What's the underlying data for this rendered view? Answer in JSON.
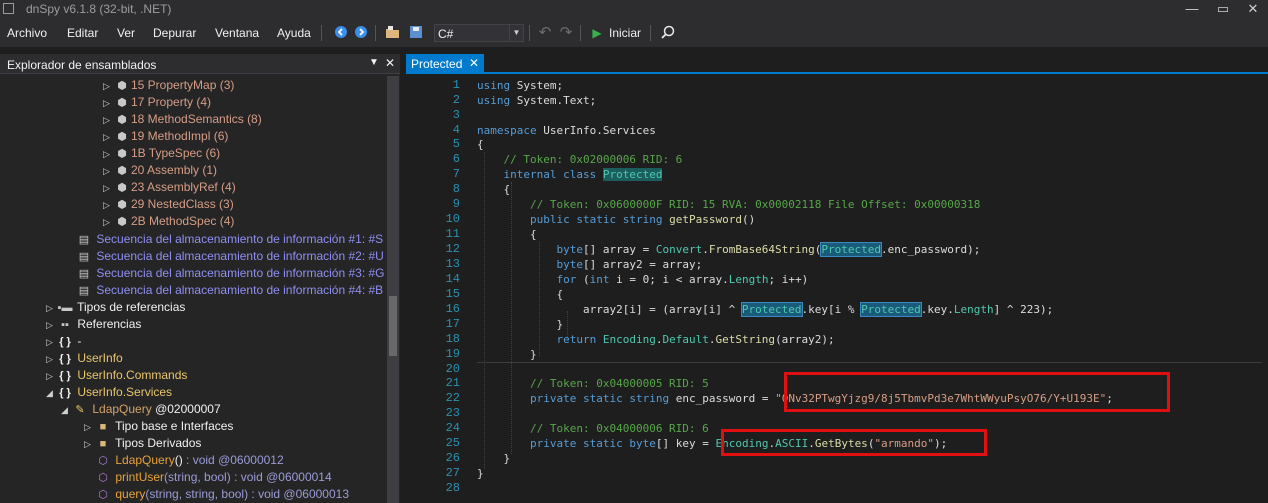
{
  "window": {
    "title": "dnSpy v6.1.8 (32-bit, .NET)"
  },
  "menu": [
    "Archivo",
    "Editar",
    "Ver",
    "Depurar",
    "Ventana",
    "Ayuda"
  ],
  "toolbar": {
    "language": "C#",
    "start_label": "Iniciar"
  },
  "explorer": {
    "title": "Explorador de ensamblados",
    "tables": [
      "15 PropertyMap (3)",
      "17 Property (4)",
      "18 MethodSemantics (8)",
      "19 MethodImpl (6)",
      "1B TypeSpec (6)",
      "20 Assembly (1)",
      "23 AssemblyRef (4)",
      "29 NestedClass (3)",
      "2B MethodSpec (4)"
    ],
    "streams": [
      "Secuencia del almacenamiento de información #1: #S",
      "Secuencia del almacenamiento de información #2: #U",
      "Secuencia del almacenamiento de información #3: #G",
      "Secuencia del almacenamiento de información #4: #B"
    ],
    "tipos_referencias": "Tipos de referencias",
    "referencias": "Referencias",
    "ns_empty": "-",
    "ns_userinfo": "UserInfo",
    "ns_commands": "UserInfo.Commands",
    "ns_services": "UserInfo.Services",
    "class_name": "LdapQuery",
    "class_token": "@02000007",
    "tipo_base": "Tipo base e Interfaces",
    "tipos_derivados": "Tipos Derivados",
    "m1_name": "LdapQuery",
    "m1_params": "()",
    "m1_ret": " : void @06000012",
    "m2_name": "printUser",
    "m2_params": "(string, bool)",
    "m2_ret": " : void @06000014",
    "m3_name": "query",
    "m3_params": "(string, string, bool)",
    "m3_ret": " : void @06000013"
  },
  "editor": {
    "tab_label": "Protected",
    "line_numbers": [
      "1",
      "2",
      "3",
      "4",
      "5",
      "6",
      "7",
      "8",
      "9",
      "10",
      "11",
      "12",
      "13",
      "14",
      "15",
      "16",
      "17",
      "18",
      "19",
      "20",
      "21",
      "22",
      "23",
      "24",
      "25",
      "26",
      "27",
      "28"
    ],
    "code": {
      "using": "using",
      "system": "System",
      "system_text": "System.Text",
      "namespace_kw": "namespace",
      "namespace_name": "UserInfo.Services",
      "token_class": "// Token: 0x02000006 RID: 6",
      "internal": "internal",
      "class_kw": "class",
      "class_name": "Protected",
      "token_method": "// Token: 0x0600000F RID: 15 RVA: 0x00002118 File Offset: 0x00000318",
      "public": "public",
      "static": "static",
      "string_kw": "string",
      "method_name": "getPassword",
      "byte_kw": "byte",
      "int_kw": "int",
      "for_kw": "for",
      "return_kw": "return",
      "convert": "Convert",
      "frombase64": "FromBase64String",
      "enc_password": "enc_password",
      "key": "key",
      "length": "Length",
      "xor_const": "223",
      "encoding": "Encoding",
      "default": "Default",
      "getstring": "GetString",
      "token_field1": "// Token: 0x04000005 RID: 5",
      "private": "private",
      "enc_password_value": "\"0Nv32PTwgYjzg9/8j5TbmvPd3e7WhtWWyuPsyO76/Y+U193E\"",
      "token_field2": "// Token: 0x04000006 RID: 6",
      "ascii": "ASCII",
      "getbytes": "GetBytes",
      "key_value": "\"armando\""
    }
  }
}
